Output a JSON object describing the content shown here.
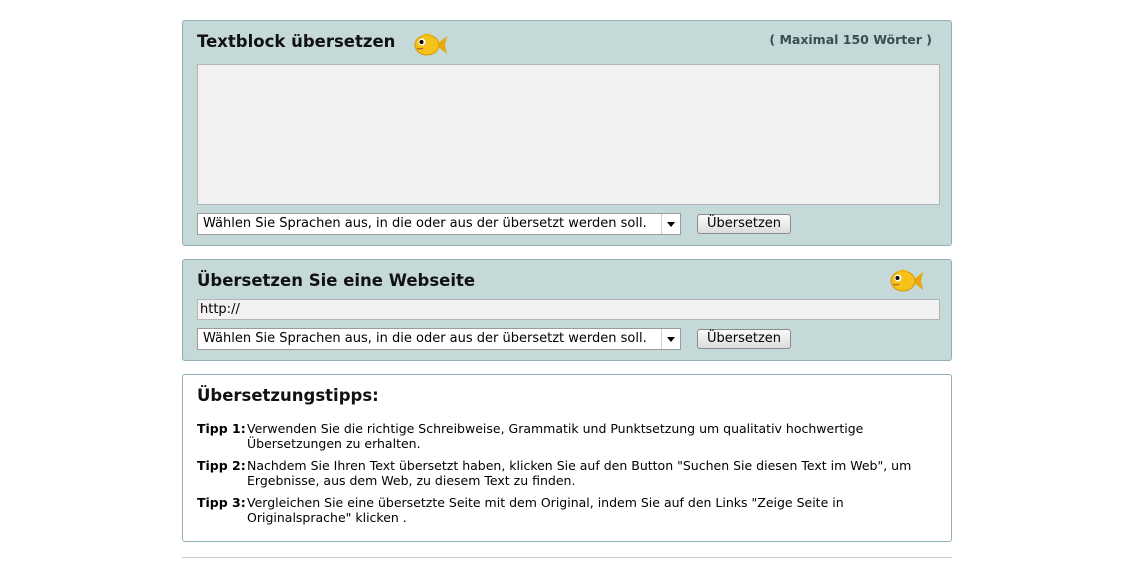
{
  "text_panel": {
    "title": "Textblock übersetzen",
    "note": "( Maximal 150 Wörter )",
    "textarea_value": "",
    "language_select": "Wählen Sie Sprachen aus, in die oder aus der übersetzt werden soll.",
    "translate_button": "Übersetzen",
    "icon": "fish-icon"
  },
  "web_panel": {
    "title": "Übersetzen Sie eine Webseite",
    "url_value": "http://",
    "language_select": "Wählen Sie Sprachen aus, in die oder aus der übersetzt werden soll.",
    "translate_button": "Übersetzen",
    "icon": "fish-icon"
  },
  "tips": {
    "title": "Übersetzungstipps:",
    "items": [
      {
        "label": "Tipp 1:",
        "text": "Verwenden Sie die richtige Schreibweise, Grammatik und Punktsetzung um qualitativ hochwertige Übersetzungen zu erhalten."
      },
      {
        "label": "Tipp 2:",
        "text": "Nachdem Sie Ihren Text übersetzt haben, klicken Sie auf den Button \"Suchen Sie diesen Text im Web\", um Ergebnisse, aus dem Web, zu diesem Text zu finden."
      },
      {
        "label": "Tipp 3:",
        "text": "Vergleichen Sie eine übersetzte Seite mit dem Original, indem Sie auf den Links \"Zeige Seite in Originalsprache\" klicken ."
      }
    ]
  },
  "colors": {
    "panel_bg": "#c5d9d9",
    "panel_border": "#8fb0b7",
    "fish_body": "#f6c21a"
  }
}
